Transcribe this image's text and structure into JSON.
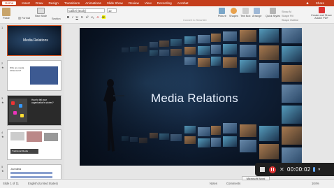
{
  "menubar": {
    "tabs": [
      "Home",
      "Insert",
      "Draw",
      "Design",
      "Transitions",
      "Animations",
      "Slide Show",
      "Review",
      "View",
      "Recording",
      "Acrobat"
    ],
    "share_label": "Share"
  },
  "ribbon": {
    "paste_label": "Paste",
    "format_label": "Format",
    "new_slide_label": "New Slide",
    "section_label": "Section",
    "font_name": "Calibri (Body)",
    "font_size": "12",
    "convert_label": "Convert to SmartArt",
    "picture_label": "Picture",
    "shapes_label": "Shapes",
    "textbox_label": "Text Box",
    "arrange_label": "Arrange",
    "quick_styles_label": "Quick Styles",
    "shape_fill_label": "Shape Fill",
    "shape_outline_label": "Shape Outline",
    "create_pdf_label": "Create and Share Adobe PDF",
    "show_ai_label": "Show AI"
  },
  "thumbnails": [
    {
      "num": "1",
      "title": "Media Relations"
    },
    {
      "num": "2",
      "title": "Who are media influencers?"
    },
    {
      "num": "3",
      "title": "How to tell your organization's stories?"
    },
    {
      "num": "4",
      "title": "Traditional Media"
    },
    {
      "num": "5",
      "title": "Journalists"
    }
  ],
  "slide": {
    "title": "Media Relations"
  },
  "statusbar": {
    "slide_counter": "Slide 1 of 11",
    "language": "English (United States)",
    "notes_label": "Notes",
    "comments_label": "Comments",
    "zoom": "104%"
  },
  "recorder": {
    "elapsed": "00:00:02",
    "tooltip": "Microsoft Word"
  },
  "colors": {
    "accent": "#c43e1c",
    "slide_bg": "#0c1a2e",
    "title_text": "#eaf2ff"
  }
}
